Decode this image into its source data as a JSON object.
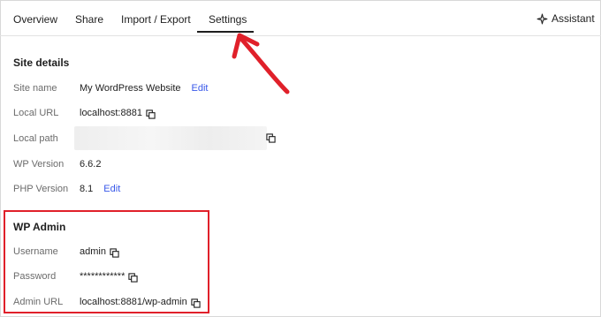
{
  "tabs": [
    {
      "label": "Overview"
    },
    {
      "label": "Share"
    },
    {
      "label": "Import / Export"
    },
    {
      "label": "Settings",
      "active": true
    }
  ],
  "assistant": {
    "label": "Assistant",
    "icon": "sparkle-icon"
  },
  "site_details": {
    "title": "Site details",
    "site_name": {
      "label": "Site name",
      "value": "My WordPress Website",
      "action": "Edit"
    },
    "local_url": {
      "label": "Local URL",
      "value": "localhost:8881"
    },
    "local_path": {
      "label": "Local path",
      "value": ""
    },
    "wp_version": {
      "label": "WP Version",
      "value": "6.6.2"
    },
    "php_version": {
      "label": "PHP Version",
      "value": "8.1",
      "action": "Edit"
    }
  },
  "wp_admin": {
    "title": "WP Admin",
    "username": {
      "label": "Username",
      "value": "admin"
    },
    "password": {
      "label": "Password",
      "value": "************"
    },
    "admin_url": {
      "label": "Admin URL",
      "value": "localhost:8881/wp-admin"
    }
  },
  "colors": {
    "link": "#3858e9",
    "highlight": "#e0202a",
    "active_tab": "#1e1e1e"
  }
}
